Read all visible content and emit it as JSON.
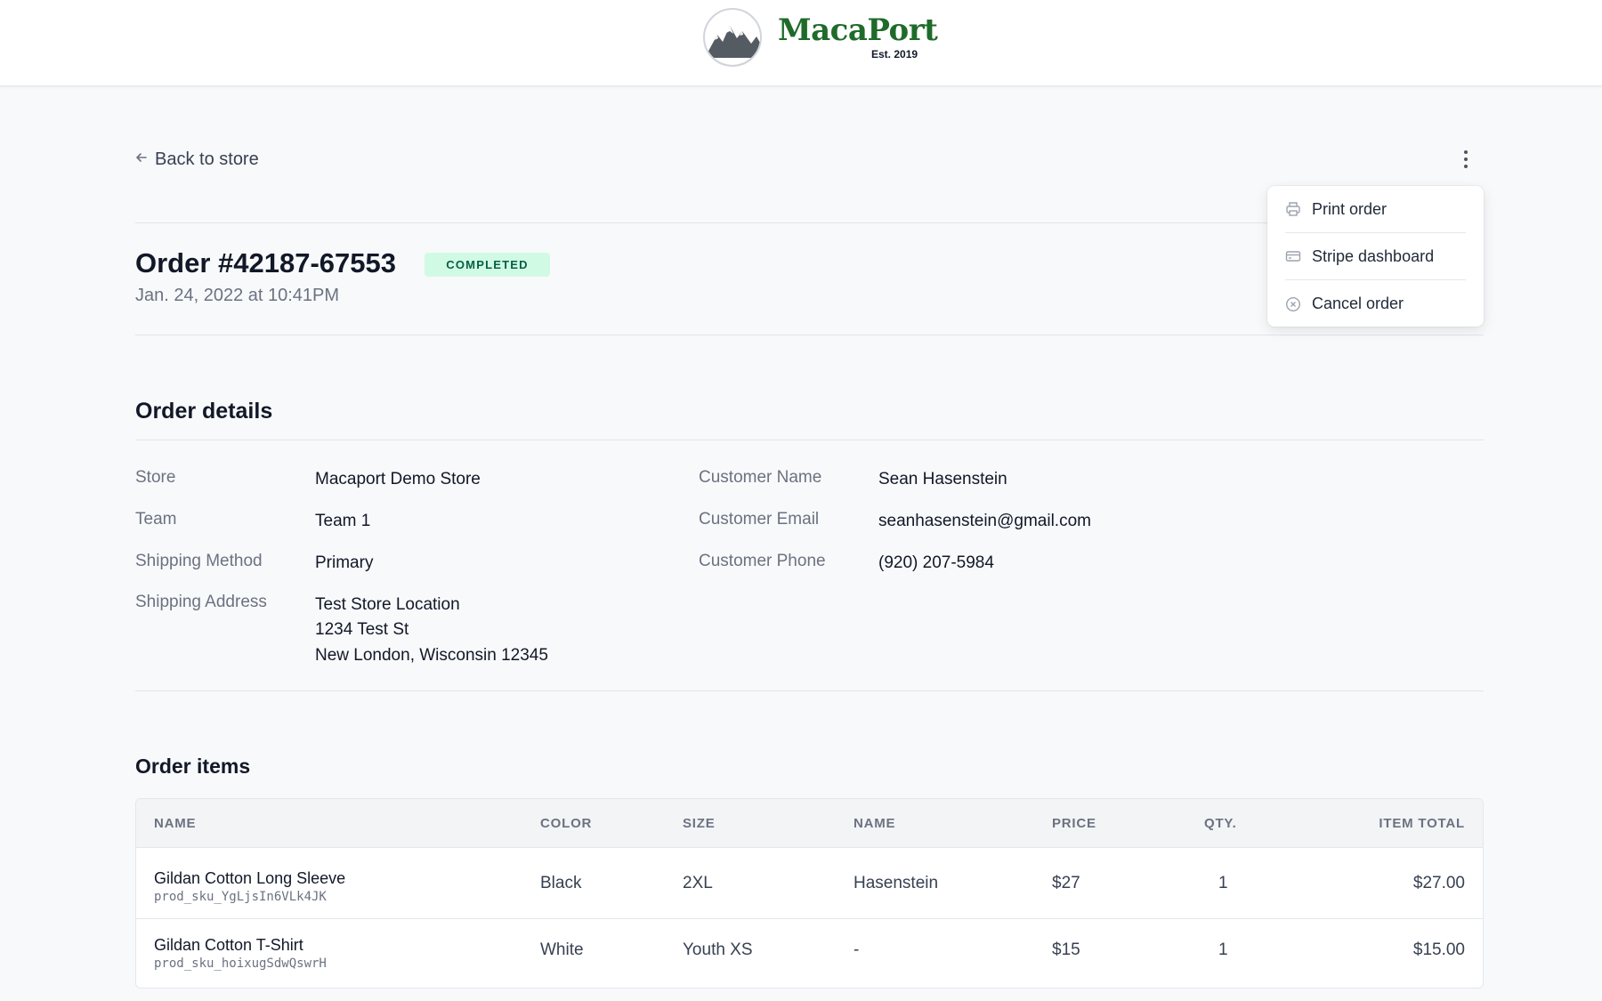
{
  "header": {
    "brand": "MacaPort",
    "brand_sub": "Est. 2019"
  },
  "nav": {
    "back_label": "Back to store"
  },
  "order": {
    "title": "Order #42187-67553",
    "status": "COMPLETED",
    "date": "Jan. 24, 2022 at 10:41PM"
  },
  "menu": {
    "items": [
      {
        "label": "Print order",
        "icon": "printer-icon"
      },
      {
        "label": "Stripe dashboard",
        "icon": "credit-card-icon"
      },
      {
        "label": "Cancel order",
        "icon": "x-circle-icon"
      }
    ]
  },
  "details": {
    "title": "Order details",
    "left": [
      {
        "label": "Store",
        "value": "Macaport Demo Store"
      },
      {
        "label": "Team",
        "value": "Team 1"
      },
      {
        "label": "Shipping Method",
        "value": "Primary"
      },
      {
        "label": "Shipping Address",
        "lines": [
          "Test Store Location",
          "1234 Test St",
          "New London, Wisconsin 12345"
        ]
      }
    ],
    "right": [
      {
        "label": "Customer Name",
        "value": "Sean Hasenstein"
      },
      {
        "label": "Customer Email",
        "value": "seanhasenstein@gmail.com"
      },
      {
        "label": "Customer Phone",
        "value": "(920) 207-5984"
      }
    ]
  },
  "items": {
    "title": "Order items",
    "columns": [
      "NAME",
      "COLOR",
      "SIZE",
      "NAME",
      "PRICE",
      "QTY.",
      "ITEM TOTAL"
    ],
    "rows": [
      {
        "name": "Gildan Cotton Long Sleeve",
        "sku": "prod_sku_YgLjsIn6VLk4JK",
        "color": "Black",
        "size": "2XL",
        "custom_name": "Hasenstein",
        "price": "$27",
        "qty": "1",
        "total": "$27.00"
      },
      {
        "name": "Gildan Cotton T-Shirt",
        "sku": "prod_sku_hoixugSdwQswrH",
        "color": "White",
        "size": "Youth XS",
        "custom_name": "-",
        "price": "$15",
        "qty": "1",
        "total": "$15.00"
      }
    ]
  },
  "colors": {
    "brand_green": "#1f6b2a",
    "status_bg": "#d1fae5",
    "status_text": "#065f46"
  }
}
